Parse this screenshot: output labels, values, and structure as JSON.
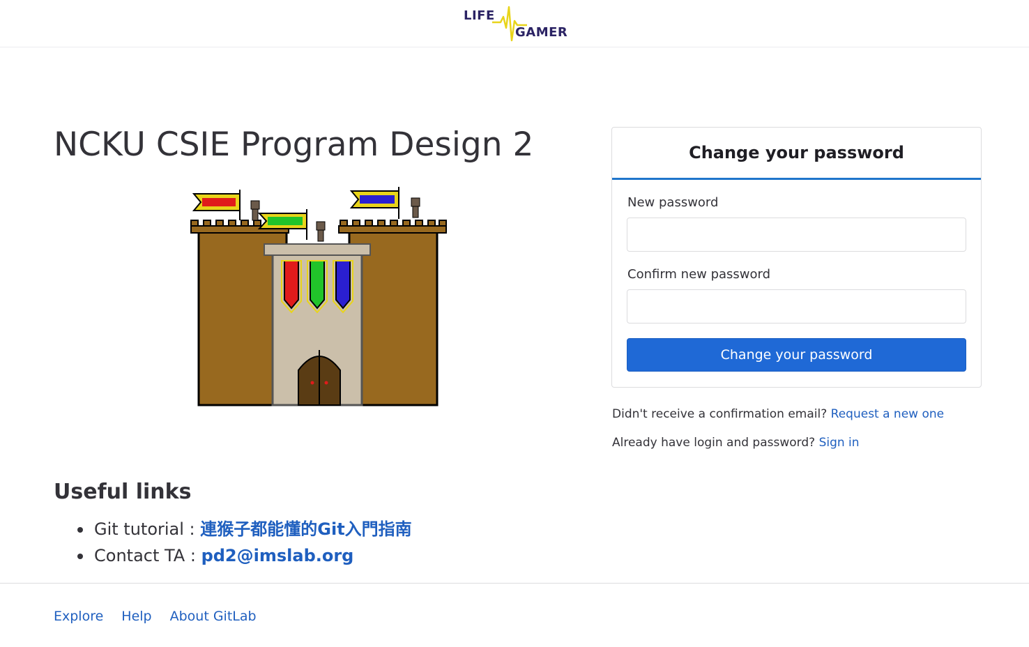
{
  "header": {
    "logo_word_top": "LIFE",
    "logo_word_bottom": "GAMER",
    "logo_icon": "heartbeat-pulse-icon",
    "logo_colors": {
      "text": "#2b2364",
      "pulse": "#e8d41a"
    }
  },
  "main": {
    "title": "NCKU CSIE Program Design 2",
    "illustration": "pixel-castle-image"
  },
  "useful_links": {
    "heading": "Useful links",
    "items": [
      {
        "label": "Git tutorial : ",
        "link_text": "連猴子都能懂的Git入門指南"
      },
      {
        "label": "Contact TA : ",
        "link_text": "pd2@imslab.org"
      }
    ]
  },
  "form": {
    "title": "Change your password",
    "new_password_label": "New password",
    "new_password_value": "",
    "confirm_password_label": "Confirm new password",
    "confirm_password_value": "",
    "submit_label": "Change your password"
  },
  "aux": {
    "confirmation_text": "Didn't receive a confirmation email? ",
    "confirmation_link": "Request a new one",
    "signin_text": "Already have login and password? ",
    "signin_link": "Sign in"
  },
  "footer": {
    "links": [
      "Explore",
      "Help",
      "About GitLab"
    ]
  },
  "colors": {
    "accent": "#1f75cb",
    "button": "#1f69d6",
    "link": "#1f5fbf",
    "text": "#333238"
  }
}
